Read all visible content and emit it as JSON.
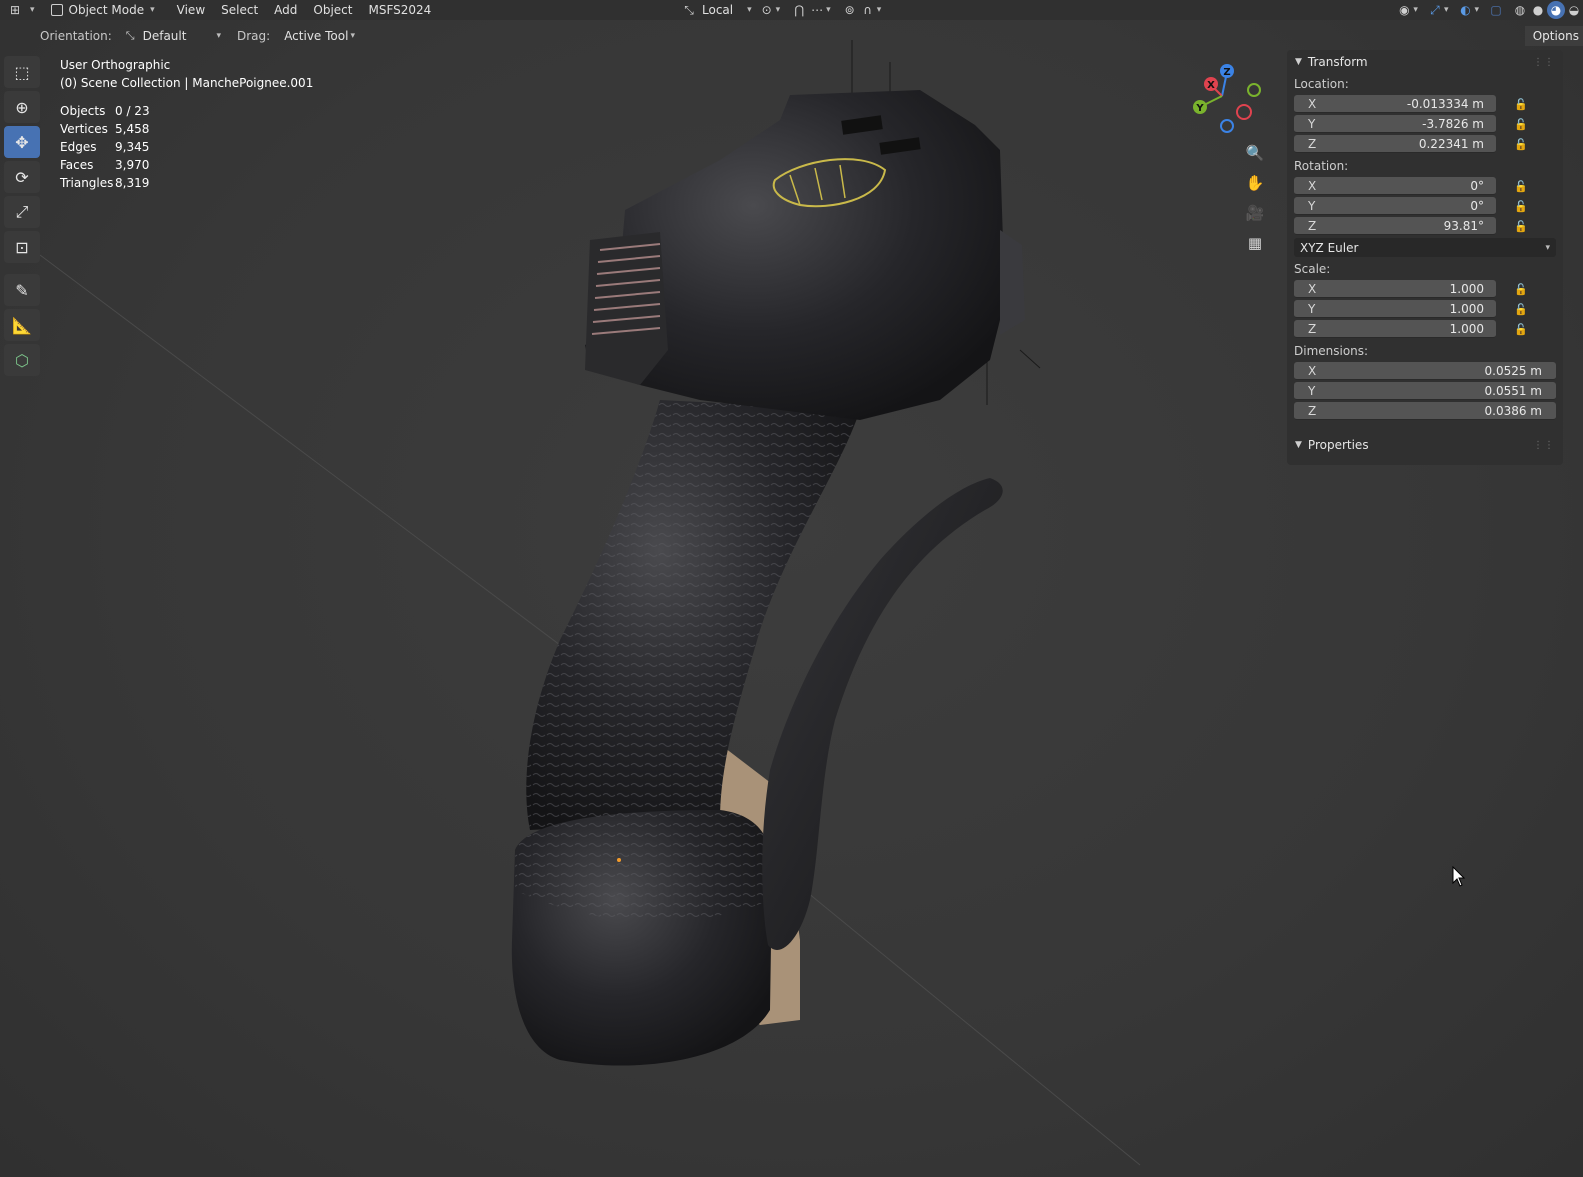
{
  "header": {
    "editor_icon": "editor-type-icon",
    "mode": "Object Mode",
    "menus": [
      "View",
      "Select",
      "Add",
      "Object",
      "MSFS2024"
    ],
    "transform_orientation": "Local"
  },
  "tool_settings": {
    "orientation_label": "Orientation:",
    "orientation_value": "Default",
    "drag_label": "Drag:",
    "drag_value": "Active Tool",
    "options_label": "Options"
  },
  "overlay": {
    "view_name": "User Orthographic",
    "collection": "(0) Scene Collection | ManchePoignee.001",
    "stats": [
      {
        "label": "Objects",
        "value": "0 / 23"
      },
      {
        "label": "Vertices",
        "value": "5,458"
      },
      {
        "label": "Edges",
        "value": "9,345"
      },
      {
        "label": "Faces",
        "value": "3,970"
      },
      {
        "label": "Triangles",
        "value": "8,319"
      }
    ]
  },
  "gizmo": {
    "x": "X",
    "y": "Y",
    "z": "Z"
  },
  "toolbar": [
    "select-box",
    "cursor",
    "move",
    "rotate",
    "scale",
    "transform",
    "annotate",
    "measure",
    "add-cube"
  ],
  "npanel": {
    "transform_title": "Transform",
    "location_label": "Location:",
    "location": [
      {
        "axis": "X",
        "value": "-0.013334 m"
      },
      {
        "axis": "Y",
        "value": "-3.7826 m"
      },
      {
        "axis": "Z",
        "value": "0.22341 m"
      }
    ],
    "rotation_label": "Rotation:",
    "rotation": [
      {
        "axis": "X",
        "value": "0°"
      },
      {
        "axis": "Y",
        "value": "0°"
      },
      {
        "axis": "Z",
        "value": "93.81°"
      }
    ],
    "rotation_mode": "XYZ Euler",
    "scale_label": "Scale:",
    "scale": [
      {
        "axis": "X",
        "value": "1.000"
      },
      {
        "axis": "Y",
        "value": "1.000"
      },
      {
        "axis": "Z",
        "value": "1.000"
      }
    ],
    "dimensions_label": "Dimensions:",
    "dimensions": [
      {
        "axis": "X",
        "value": "0.0525 m"
      },
      {
        "axis": "Y",
        "value": "0.0551 m"
      },
      {
        "axis": "Z",
        "value": "0.0386 m"
      }
    ],
    "properties_title": "Properties"
  },
  "colors": {
    "accent": "#4772b3",
    "axis_x": "#e0434f",
    "axis_y": "#7ab32d",
    "axis_z": "#3b83e6"
  }
}
